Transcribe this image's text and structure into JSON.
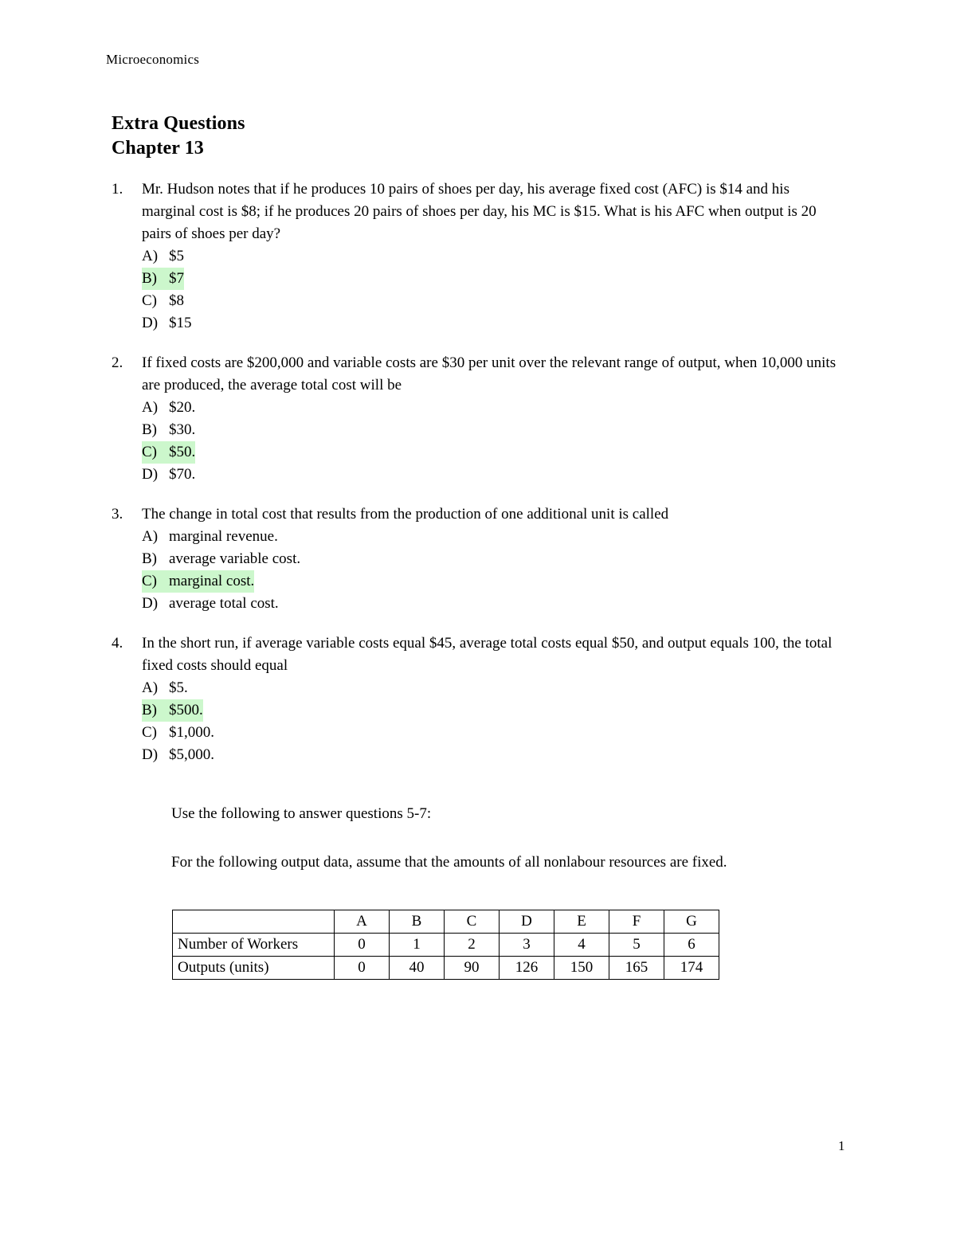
{
  "header": {
    "running_title": "Microeconomics"
  },
  "title": {
    "line1": "Extra Questions",
    "line2": "Chapter 13"
  },
  "questions": [
    {
      "number": "1.",
      "stem": "Mr. Hudson notes that if he produces 10 pairs of shoes per day, his average fixed cost (AFC) is $14 and his marginal cost is $8; if he produces 20 pairs of shoes per day, his MC is $15. What is his AFC when output is 20 pairs of shoes per day?",
      "options": [
        {
          "letter": "A)",
          "text": "$5",
          "correct": false
        },
        {
          "letter": "B)",
          "text": "$7",
          "correct": true
        },
        {
          "letter": "C)",
          "text": "$8",
          "correct": false
        },
        {
          "letter": "D)",
          "text": "$15",
          "correct": false
        }
      ]
    },
    {
      "number": "2.",
      "stem": "If fixed costs are $200,000 and variable costs are $30 per unit over the relevant range of output, when 10,000 units are produced, the average total cost will be",
      "options": [
        {
          "letter": "A)",
          "text": "$20.",
          "correct": false
        },
        {
          "letter": "B)",
          "text": "$30.",
          "correct": false
        },
        {
          "letter": "C)",
          "text": "$50.",
          "correct": true
        },
        {
          "letter": "D)",
          "text": "$70.",
          "correct": false
        }
      ]
    },
    {
      "number": "3.",
      "stem": "The change in total cost that results from the production of one additional unit is called",
      "options": [
        {
          "letter": "A)",
          "text": "marginal revenue.",
          "correct": false
        },
        {
          "letter": "B)",
          "text": "average variable cost.",
          "correct": false
        },
        {
          "letter": "C)",
          "text": "marginal cost.",
          "correct": true
        },
        {
          "letter": "D)",
          "text": "average total cost.",
          "correct": false
        }
      ]
    },
    {
      "number": "4.",
      "stem": "In the short run, if average variable costs equal $45, average total costs equal $50, and output equals 100, the total fixed costs should equal",
      "options": [
        {
          "letter": "A)",
          "text": "$5.",
          "correct": false
        },
        {
          "letter": "B)",
          "text": "$500.",
          "correct": true
        },
        {
          "letter": "C)",
          "text": "$1,000.",
          "correct": false
        },
        {
          "letter": "D)",
          "text": "$5,000.",
          "correct": false
        }
      ]
    }
  ],
  "instructions": {
    "line1": "Use the following to answer questions 5-7:",
    "line2": " For the following output data, assume that the amounts of all nonlabour resources are fixed."
  },
  "table": {
    "corner": "",
    "column_headers": [
      "A",
      "B",
      "C",
      "D",
      "E",
      "F",
      "G"
    ],
    "rows": [
      {
        "label": "Number of Workers",
        "values": [
          "0",
          "1",
          "2",
          "3",
          "4",
          "5",
          "6"
        ]
      },
      {
        "label": "Outputs (units)",
        "values": [
          "0",
          "40",
          "90",
          "126",
          "150",
          "165",
          "174"
        ]
      }
    ]
  },
  "footer": {
    "page_number": "1"
  },
  "colors": {
    "highlight": "#ccf7cc",
    "text": "#000000",
    "background": "#ffffff"
  }
}
